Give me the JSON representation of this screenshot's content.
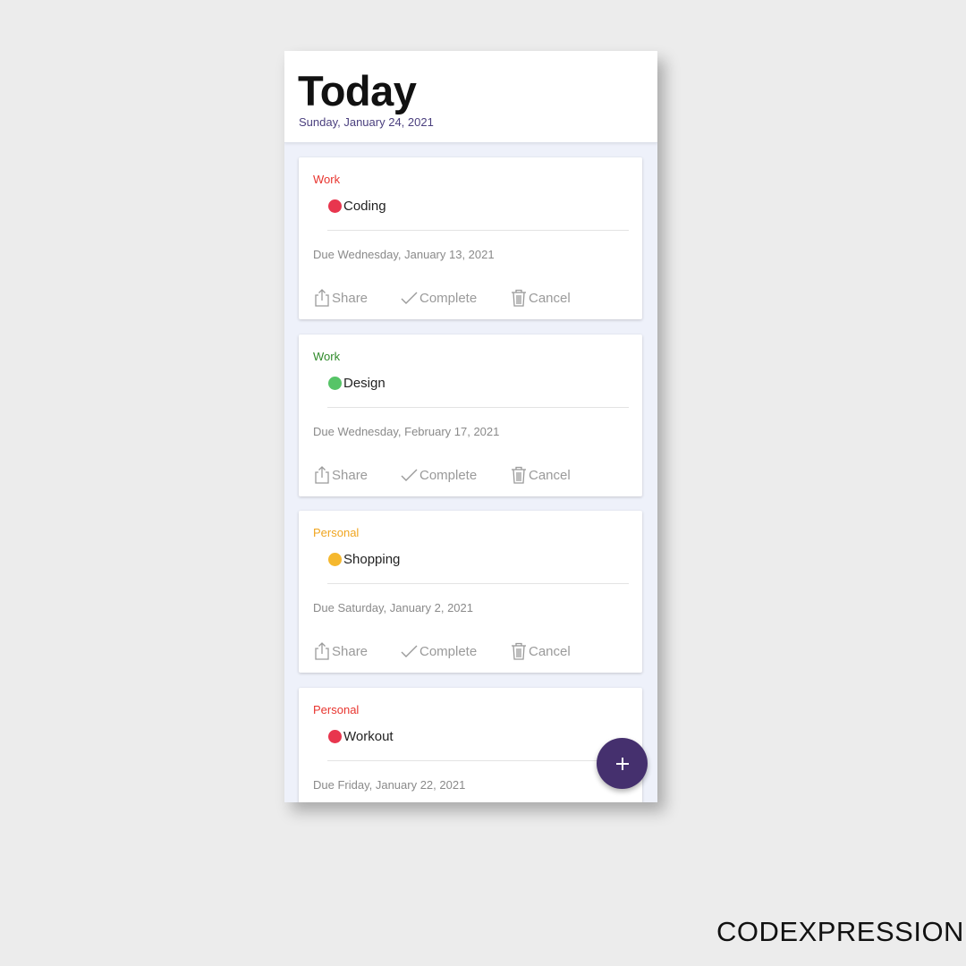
{
  "header": {
    "title": "Today",
    "date": "Sunday, January 24, 2021"
  },
  "actions": {
    "share": "Share",
    "complete": "Complete",
    "cancel": "Cancel"
  },
  "tasks": [
    {
      "category": "Work",
      "category_color": "#e8352f",
      "name": "Coding",
      "dot_color": "#e8364e",
      "due": "Due Wednesday, January 13, 2021"
    },
    {
      "category": "Work",
      "category_color": "#2f8a2a",
      "name": "Design",
      "dot_color": "#56c467",
      "due": "Due Wednesday, February 17, 2021"
    },
    {
      "category": "Personal",
      "category_color": "#f0a51f",
      "name": "Shopping",
      "dot_color": "#f5b82e",
      "due": "Due Saturday, January 2, 2021"
    },
    {
      "category": "Personal",
      "category_color": "#e8352f",
      "name": "Workout",
      "dot_color": "#e8364e",
      "due": "Due Friday, January 22, 2021"
    }
  ],
  "fab": {
    "icon": "plus-icon",
    "color": "#45306e"
  },
  "watermark": "CODEXPRESSION"
}
